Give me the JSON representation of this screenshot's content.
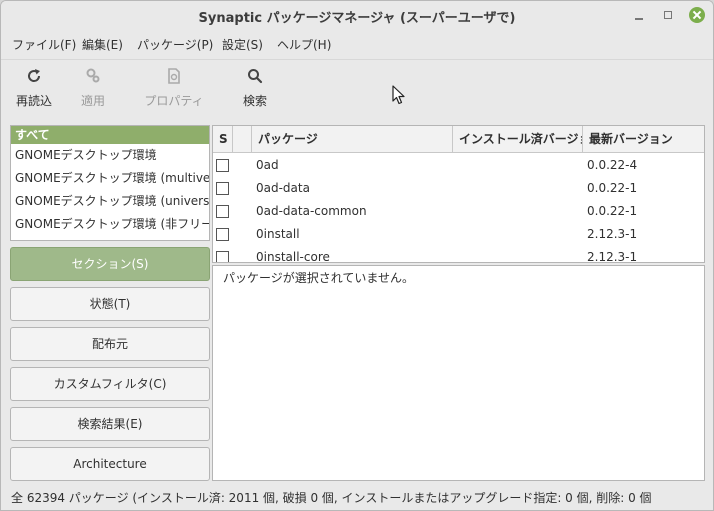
{
  "window": {
    "title": "Synaptic パッケージマネージャ (スーパーユーザで)"
  },
  "menu": [
    "ファイル(F)",
    "編集(E)",
    "パッケージ(P)",
    "設定(S)",
    "ヘルプ(H)"
  ],
  "toolbar": [
    {
      "label": "再読込",
      "icon": "refresh-icon",
      "enabled": true
    },
    {
      "label": "適用",
      "icon": "gears-icon",
      "enabled": false
    },
    {
      "label": "プロパティ",
      "icon": "document-icon",
      "enabled": false
    },
    {
      "label": "検索",
      "icon": "search-icon",
      "enabled": true
    }
  ],
  "filters": [
    "すべて",
    "GNOMEデスクトップ環境",
    "GNOMEデスクトップ環境 (multiverse)",
    "GNOMEデスクトップ環境 (universe)",
    "GNOMEデスクトップ環境 (非フリー)"
  ],
  "left_buttons": [
    "セクション(S)",
    "状態(T)",
    "配布元",
    "カスタムフィルタ(C)",
    "検索結果(E)",
    "Architecture"
  ],
  "columns": {
    "s": "S",
    "package": "パッケージ",
    "installed": "インストール済バージョン",
    "latest": "最新バージョン"
  },
  "packages": [
    {
      "name": "0ad",
      "installed": "",
      "latest": "0.0.22-4"
    },
    {
      "name": "0ad-data",
      "installed": "",
      "latest": "0.0.22-1"
    },
    {
      "name": "0ad-data-common",
      "installed": "",
      "latest": "0.0.22-1"
    },
    {
      "name": "0install",
      "installed": "",
      "latest": "2.12.3-1"
    },
    {
      "name": "0install-core",
      "installed": "",
      "latest": "2.12.3-1"
    }
  ],
  "description": "パッケージが選択されていません。",
  "status": "全 62394 パッケージ (インストール済: 2011 個, 破損 0 個, インストールまたはアップグレード指定: 0 個, 削除: 0 個",
  "colors": {
    "accent": "#8fae6b",
    "close_button": "#7cae4c"
  }
}
